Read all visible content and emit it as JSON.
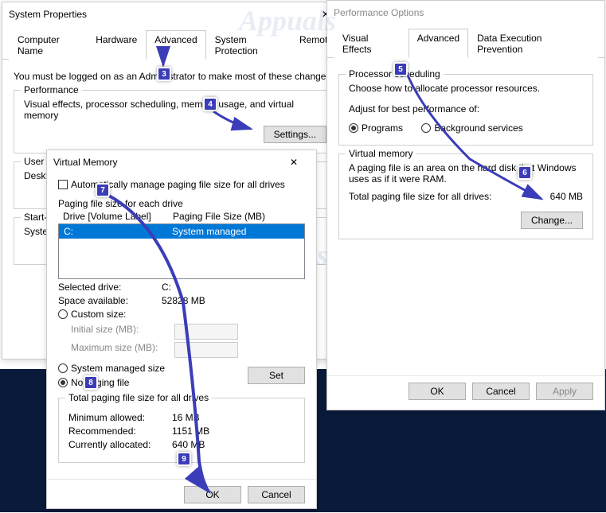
{
  "sys": {
    "title": "System Properties",
    "tabs": {
      "t0": "Computer Name",
      "t1": "Hardware",
      "t2": "Advanced",
      "t3": "System Protection",
      "t4": "Remote"
    },
    "note": "You must be logged on as an Administrator to make most of these changes.",
    "perf": {
      "title": "Performance",
      "desc": "Visual effects, processor scheduling, memory usage, and virtual memory",
      "btn": "Settings..."
    },
    "user": {
      "title": "User Profiles",
      "desc": "Desktop settings related to your sign-in"
    },
    "startup": {
      "title": "Start-up and Recovery",
      "desc": "System startup, system failure, and debugging information"
    }
  },
  "po": {
    "title": "Performance Options",
    "tabs": {
      "t0": "Visual Effects",
      "t1": "Advanced",
      "t2": "Data Execution Prevention"
    },
    "sched": {
      "title": "Processor scheduling",
      "desc": "Choose how to allocate processor resources.",
      "adjust": "Adjust for best performance of:",
      "r0": "Programs",
      "r1": "Background services"
    },
    "vm": {
      "title": "Virtual memory",
      "desc": "A paging file is an area on the hard disk that Windows uses as if it were RAM.",
      "totLbl": "Total paging file size for all drives:",
      "totVal": "640 MB",
      "btn": "Change..."
    },
    "ok": "OK",
    "cancel": "Cancel",
    "apply": "Apply"
  },
  "vm": {
    "title": "Virtual Memory",
    "auto": "Automatically manage paging file size for all drives",
    "drivesLbl": "Paging file size for each drive",
    "hdr1": "Drive  [Volume Label]",
    "hdr2": "Paging File Size (MB)",
    "drive": "C:",
    "driveStatus": "System managed",
    "selLbl": "Selected drive:",
    "selVal": "C:",
    "spLbl": "Space available:",
    "spVal": "52828 MB",
    "custom": "Custom size:",
    "initLbl": "Initial size (MB):",
    "maxLbl": "Maximum size (MB):",
    "sysRadio": "System managed size",
    "noRadio": "No paging file",
    "setBtn": "Set",
    "totTitle": "Total paging file size for all drives",
    "minLbl": "Minimum allowed:",
    "minVal": "16 MB",
    "recLbl": "Recommended:",
    "recVal": "1151 MB",
    "curLbl": "Currently allocated:",
    "curVal": "640 MB",
    "ok": "OK",
    "cancel": "Cancel"
  },
  "markers": {
    "m3": "3",
    "m4": "4",
    "m5": "5",
    "m6": "6",
    "m7": "7",
    "m8": "8",
    "m9": "9"
  }
}
